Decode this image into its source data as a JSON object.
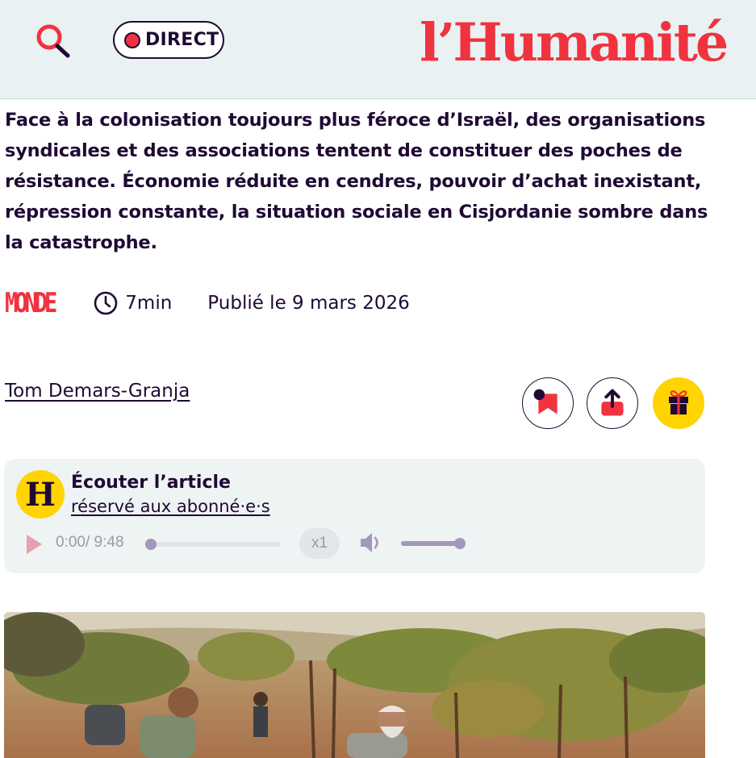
{
  "header": {
    "search_icon": "search-icon",
    "direct_label": "DIRECT",
    "logo_text": "l’Humanité"
  },
  "article": {
    "chapo": "Face à la colonisation toujours plus féroce d’Israël, des organisations syndicales et des associations tentent de constituer des poches de résistance. Économie réduite en cendres, pouvoir d’achat inexistant, répression constante, la situation sociale en Cisjordanie sombre dans la catastrophe.",
    "rubrique": "MONDE",
    "read_time": "7min",
    "published": "Publié le 9 mars 2026",
    "author": "Tom Demars-Granja"
  },
  "actions": {
    "bookmark_icon": "bookmark-icon",
    "share_icon": "share-icon",
    "gift_icon": "gift-icon"
  },
  "player": {
    "logo_letter": "H",
    "title": "Écouter l’article",
    "subtitle": "réservé aux abonné·e·s",
    "time": "0:00/ 9:48",
    "speed": "x1",
    "progress": 0,
    "volume": 1
  },
  "colors": {
    "brand_red": "#f0333f",
    "ink": "#1f0a33",
    "header_bg": "#eaf1f2",
    "gift_yellow": "#ffd400",
    "player_bg": "#eef3f4"
  }
}
